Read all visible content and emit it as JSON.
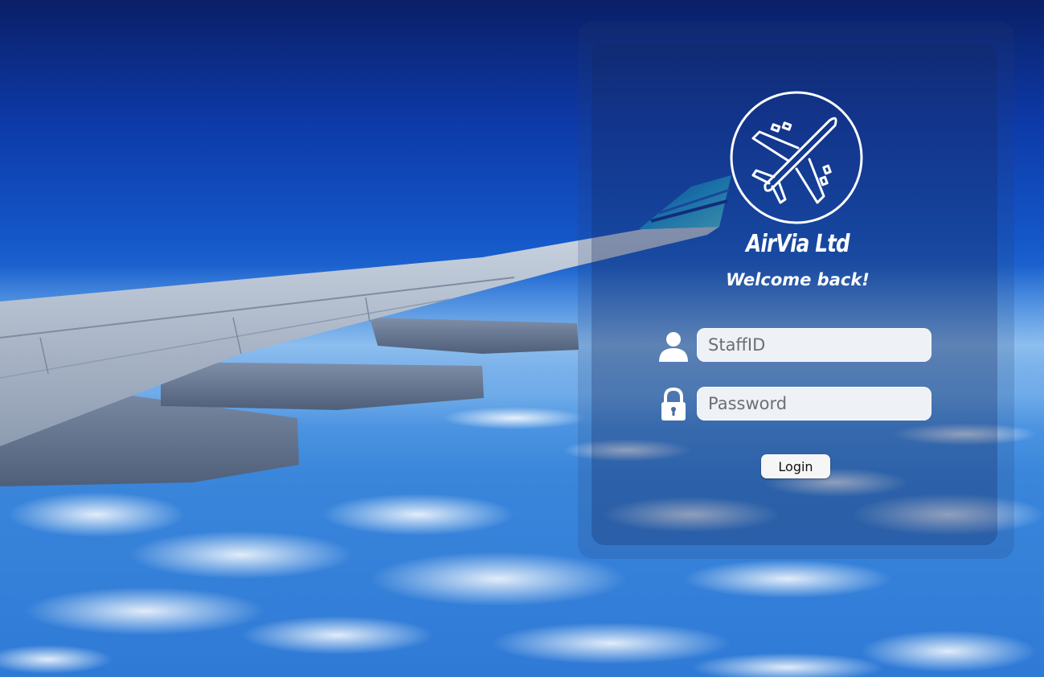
{
  "brand": {
    "name": "AirVia Ltd",
    "logo_icon": "airplane-circle-logo"
  },
  "greeting": "Welcome back!",
  "form": {
    "staff_id": {
      "placeholder": "StaffID",
      "value": "",
      "icon": "user-icon"
    },
    "password": {
      "placeholder": "Password",
      "value": "",
      "icon": "lock-icon"
    },
    "login_label": "Login"
  },
  "colors": {
    "sky_top": "#0a1f66",
    "sky_mid": "#1456c8",
    "panel_tint": "#14285f",
    "text": "#ffffff",
    "field_bg": "#eef1f5"
  }
}
